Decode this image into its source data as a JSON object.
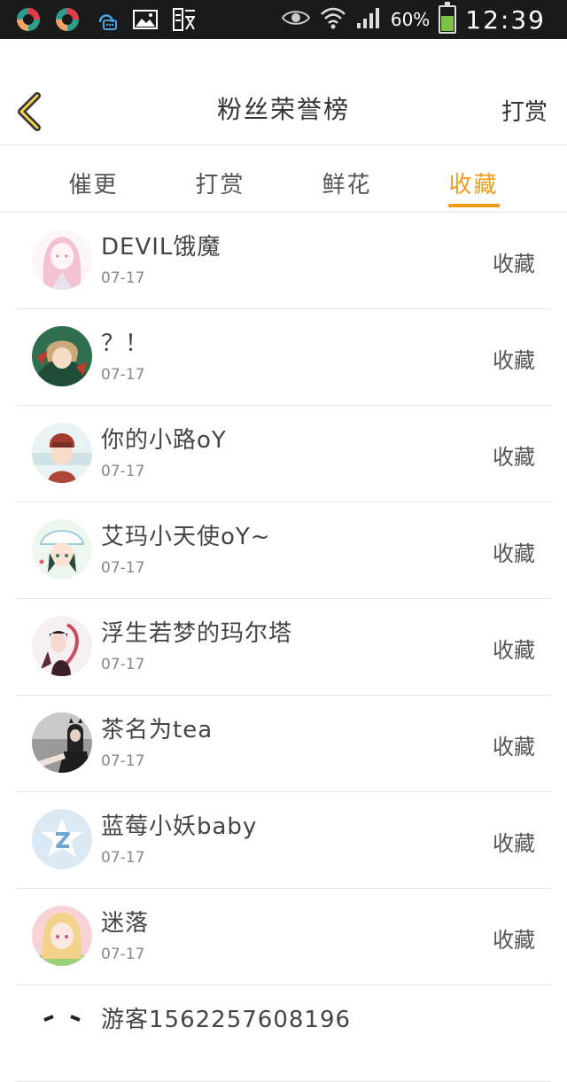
{
  "status_bar": {
    "battery": "60%",
    "time": "12:39",
    "colors": {
      "background": "#1a1a1a",
      "battery_fill": "#7dc243"
    },
    "left_icons": [
      "app-circle-icon",
      "app-circle-icon",
      "qq-message-icon",
      "image-icon",
      "stock-icon"
    ],
    "right_icons": [
      "eye-icon",
      "wifi-icon",
      "signal-icon",
      "battery-icon"
    ]
  },
  "header": {
    "title": "粉丝荣誉榜",
    "action": "打赏",
    "back_icon": "back-chevron-icon"
  },
  "tabs": [
    {
      "label": "催更",
      "active": false
    },
    {
      "label": "打赏",
      "active": false
    },
    {
      "label": "鲜花",
      "active": false
    },
    {
      "label": "收藏",
      "active": true
    }
  ],
  "accent_color": "#f09d1a",
  "list": [
    {
      "name": "DEVIL饿魔",
      "date": "07-17",
      "action": "收藏"
    },
    {
      "name": "？！",
      "date": "07-17",
      "action": "收藏"
    },
    {
      "name": "你的小路oY",
      "date": "07-17",
      "action": "收藏"
    },
    {
      "name": "艾玛小天使oY~",
      "date": "07-17",
      "action": "收藏"
    },
    {
      "name": "浮生若梦的玛尔塔",
      "date": "07-17",
      "action": "收藏"
    },
    {
      "name": "茶名为tea",
      "date": "07-17",
      "action": "收藏"
    },
    {
      "name": "蓝莓小妖baby",
      "date": "07-17",
      "action": "收藏"
    },
    {
      "name": "迷落",
      "date": "07-17",
      "action": "收藏"
    },
    {
      "name": "游客1562257608196",
      "date": "",
      "action": ""
    }
  ]
}
